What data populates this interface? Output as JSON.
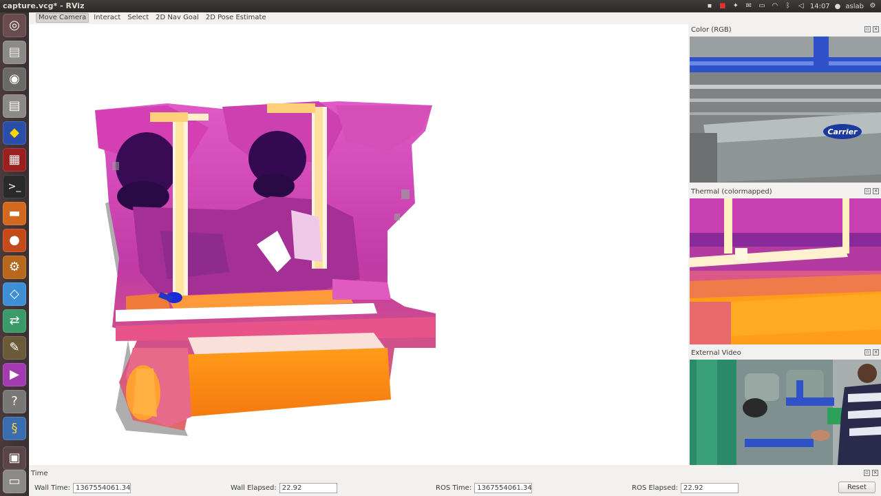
{
  "window": {
    "title": "capture.vcg* - RViz"
  },
  "tray": {
    "clock": "14:07",
    "user": "aslab"
  },
  "toolbar": {
    "tools": [
      "Move Camera",
      "Interact",
      "Select",
      "2D Nav Goal",
      "2D Pose Estimate"
    ],
    "active": "Move Camera"
  },
  "panels": {
    "color": {
      "title": "Color (RGB)",
      "brand_text": "Carrier"
    },
    "thermal": {
      "title": "Thermal (colormapped)"
    },
    "external": {
      "title": "External Video"
    }
  },
  "time": {
    "title": "Time",
    "wall_time_label": "Wall Time:",
    "wall_time": "1367554061.34",
    "wall_elapsed_label": "Wall Elapsed:",
    "wall_elapsed": "22.92",
    "ros_time_label": "ROS Time:",
    "ros_time": "1367554061.34",
    "ros_elapsed_label": "ROS Elapsed:",
    "ros_elapsed": "22.92",
    "reset_label": "Reset"
  },
  "launcher": {
    "icons": [
      "ubuntu-dash-icon",
      "disk-icon",
      "eye-icon",
      "disk2-icon",
      "globe-icon",
      "workspace-icon",
      "terminal-icon",
      "files-icon",
      "firefox-icon",
      "settings-icon",
      "dropbox-icon",
      "network-icon",
      "gimp-icon",
      "video-editor-icon",
      "help-icon",
      "python-icon",
      "window-icon",
      "drive-icon"
    ]
  },
  "colors": {
    "accent": "#f07746",
    "thermal_hot": "#ff9a10",
    "thermal_cold": "#2a0a4a"
  }
}
